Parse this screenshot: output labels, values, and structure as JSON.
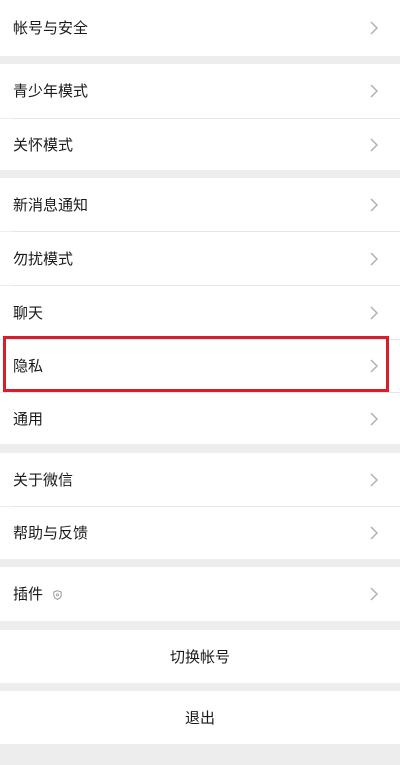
{
  "settings": {
    "account_security": "帐号与安全",
    "teen_mode": "青少年模式",
    "care_mode": "关怀模式",
    "new_message_notification": "新消息通知",
    "do_not_disturb": "勿扰模式",
    "chat": "聊天",
    "privacy": "隐私",
    "general": "通用",
    "about": "关于微信",
    "help_feedback": "帮助与反馈",
    "plugins": "插件"
  },
  "actions": {
    "switch_account": "切换帐号",
    "logout": "退出"
  },
  "icons": {
    "chevron": "chevron-right-icon",
    "plugin": "shield-icon"
  },
  "colors": {
    "highlight": "#d81e2a",
    "background": "#ededed"
  }
}
